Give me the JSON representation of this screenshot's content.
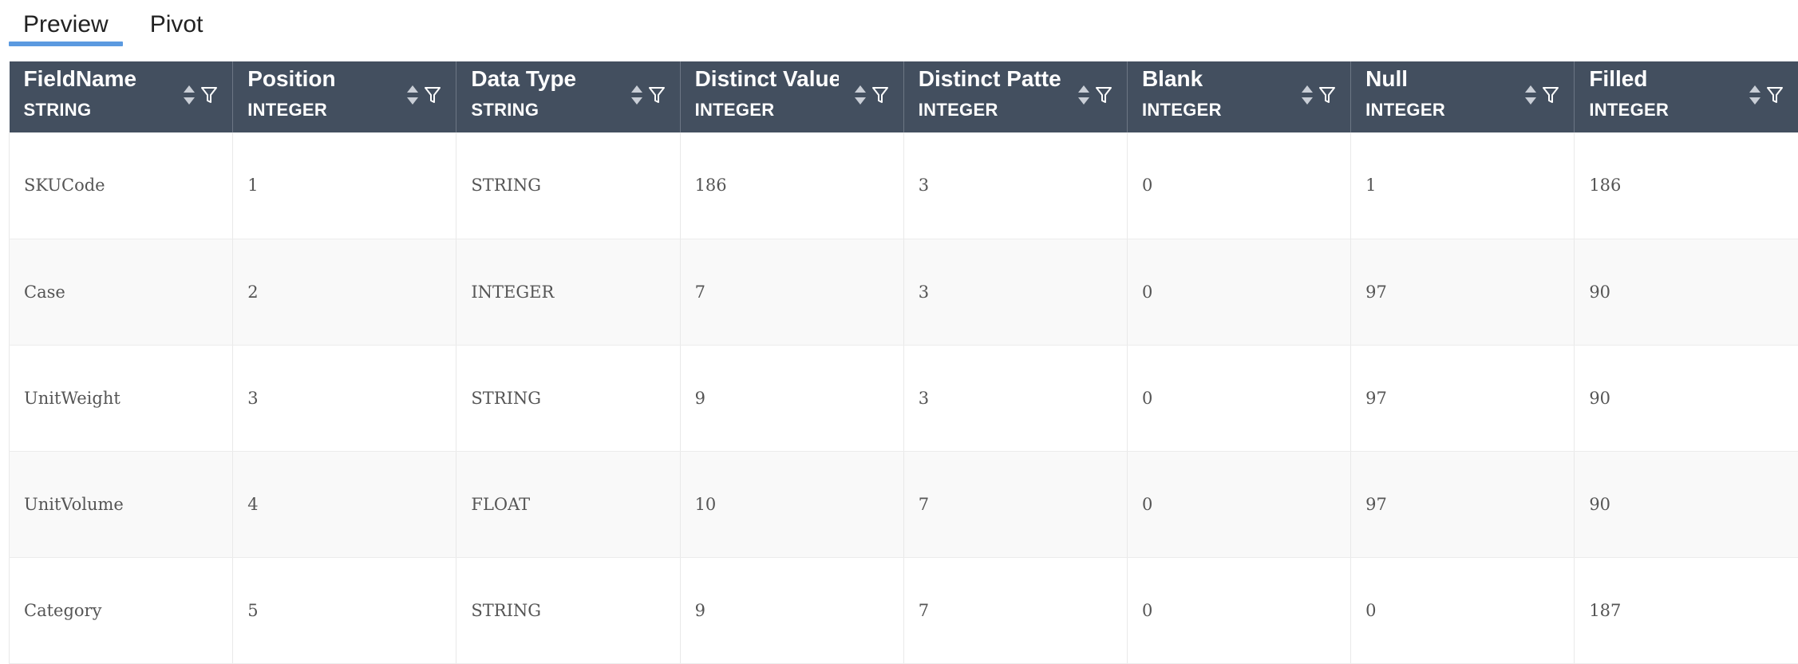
{
  "tabs": {
    "preview": "Preview",
    "pivot": "Pivot"
  },
  "columns": [
    {
      "name": "FieldName",
      "type": "STRING"
    },
    {
      "name": "Position",
      "type": "INTEGER"
    },
    {
      "name": "Data Type",
      "type": "STRING"
    },
    {
      "name": "Distinct Values",
      "type": "INTEGER"
    },
    {
      "name": "Distinct Patte...",
      "type": "INTEGER"
    },
    {
      "name": "Blank",
      "type": "INTEGER"
    },
    {
      "name": "Null",
      "type": "INTEGER"
    },
    {
      "name": "Filled",
      "type": "INTEGER"
    }
  ],
  "rows": [
    [
      "SKUCode",
      "1",
      "STRING",
      "186",
      "3",
      "0",
      "1",
      "186"
    ],
    [
      "Case",
      "2",
      "INTEGER",
      "7",
      "3",
      "0",
      "97",
      "90"
    ],
    [
      "UnitWeight",
      "3",
      "STRING",
      "9",
      "3",
      "0",
      "97",
      "90"
    ],
    [
      "UnitVolume",
      "4",
      "FLOAT",
      "10",
      "7",
      "0",
      "97",
      "90"
    ],
    [
      "Category",
      "5",
      "STRING",
      "9",
      "7",
      "0",
      "0",
      "187"
    ]
  ],
  "icons": {
    "sort": "sort-icon",
    "filter": "filter-icon"
  },
  "colors": {
    "header_bg": "#434f5f",
    "tab_underline": "#5b9ae0",
    "alt_row": "#f9f9f9"
  }
}
